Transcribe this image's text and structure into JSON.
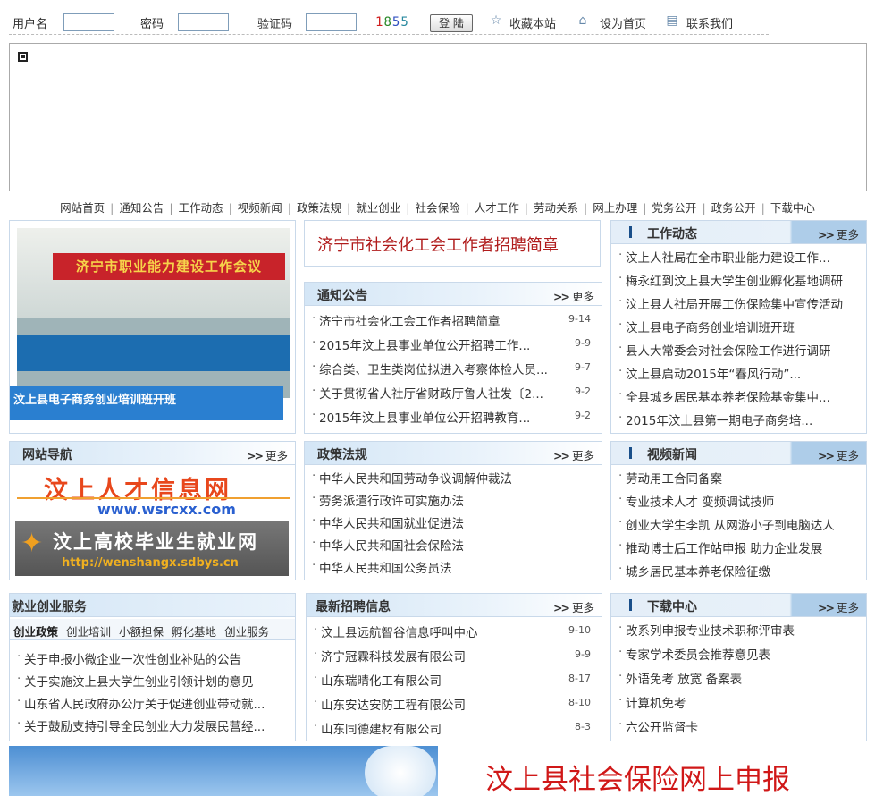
{
  "topbar": {
    "username_label": "用户名",
    "password_label": "密码",
    "captcha_label": "验证码",
    "captcha_chars": [
      "1",
      "8",
      "5",
      "5"
    ],
    "login_button": "登 陆",
    "links": [
      "收藏本站",
      "设为首页",
      "联系我们"
    ]
  },
  "nav": [
    "网站首页",
    "通知公告",
    "工作动态",
    "视频新闻",
    "政策法规",
    "就业创业",
    "社会保险",
    "人才工作",
    "劳动关系",
    "网上办理",
    "党务公开",
    "政务公开",
    "下载中心"
  ],
  "more": "更多",
  "photo": {
    "sign_text": "济宁市职业能力建设工作会议",
    "caption": "汶上县电子商务创业培训班开班"
  },
  "headline": "济宁市社会化工会工作者招聘简章",
  "notice": {
    "title": "通知公告",
    "items": [
      {
        "t": "济宁市社会化工会工作者招聘简章",
        "d": "9-14"
      },
      {
        "t": "2015年汶上县事业单位公开招聘工作...",
        "d": "9-9"
      },
      {
        "t": "综合类、卫生类岗位拟进入考察体检人员...",
        "d": "9-7"
      },
      {
        "t": "关于贯彻省人社厅省财政厅鲁人社发〔2...",
        "d": "9-2"
      },
      {
        "t": "2015年汶上县事业单位公开招聘教育...",
        "d": "9-2"
      }
    ]
  },
  "work": {
    "title": "工作动态",
    "items": [
      "汶上人社局在全市职业能力建设工作...",
      "梅永红到汶上县大学生创业孵化基地调研",
      "汶上县人社局开展工伤保险集中宣传活动",
      "汶上县电子商务创业培训班开班",
      "县人大常委会对社会保险工作进行调研",
      "汶上县启动2015年“春风行动”...",
      "全县城乡居民基本养老保险基金集中...",
      "2015年汶上县第一期电子商务培..."
    ]
  },
  "sitenav": {
    "title": "网站导航",
    "ad1_text": "汶上人才信息网",
    "ad1_url": "www.wsrcxx.com",
    "ad2_text": "汶上高校毕业生就业网",
    "ad2_url": "http://wenshangx.sdbys.cn"
  },
  "policy": {
    "title": "政策法规",
    "items": [
      "中华人民共和国劳动争议调解仲裁法",
      "劳务派遣行政许可实施办法",
      "中华人民共和国就业促进法",
      "中华人民共和国社会保险法",
      "中华人民共和国公务员法"
    ]
  },
  "video": {
    "title": "视频新闻",
    "items": [
      "劳动用工合同备案",
      "专业技术人才 变频调试技师",
      "创业大学生李凯 从网游小子到电脑达人",
      "推动博士后工作站申报 助力企业发展",
      "城乡居民基本养老保险征缴"
    ]
  },
  "jiuye": {
    "title": "就业创业服务",
    "tabs": [
      "创业政策",
      "创业培训",
      "小额担保",
      "孵化基地",
      "创业服务"
    ],
    "items": [
      "关于申报小微企业一次性创业补贴的公告",
      "关于实施汶上县大学生创业引领计划的意见",
      "山东省人民政府办公厅关于促进创业带动就...",
      "关于鼓励支持引导全民创业大力发展民营经..."
    ]
  },
  "recruit": {
    "title": "最新招聘信息",
    "items": [
      {
        "t": "汶上县远航智谷信息呼叫中心",
        "d": "9-10"
      },
      {
        "t": "济宁冠霖科技发展有限公司",
        "d": "9-9"
      },
      {
        "t": "山东瑞晴化工有限公司",
        "d": "8-17"
      },
      {
        "t": "山东安达安防工程有限公司",
        "d": "8-10"
      },
      {
        "t": "山东同德建材有限公司",
        "d": "8-3"
      }
    ]
  },
  "download": {
    "title": "下载中心",
    "items": [
      "改系列申报专业技术职称评审表",
      "专家学术委员会推荐意见表",
      "外语免考 放宽 备案表",
      "计算机免考",
      "六公开监督卡"
    ]
  },
  "bottom_title": "汶上县社会保险网上申报",
  "colors": {
    "accent_blue": "#2a7fd0",
    "headline_red": "#b01c1c",
    "bottom_red": "#d01818"
  }
}
